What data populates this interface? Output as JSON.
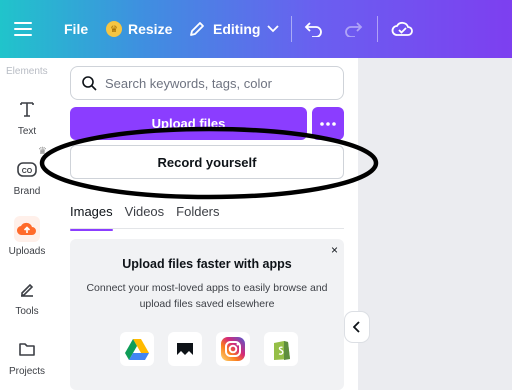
{
  "topbar": {
    "file_label": "File",
    "resize_label": "Resize",
    "editing_label": "Editing"
  },
  "rail": {
    "faded_label": "Elements",
    "items": [
      {
        "label": "Text",
        "icon": "text-icon"
      },
      {
        "label": "Brand",
        "icon": "brand-icon"
      },
      {
        "label": "Uploads",
        "icon": "uploads-icon"
      },
      {
        "label": "Tools",
        "icon": "tools-icon"
      },
      {
        "label": "Projects",
        "icon": "projects-icon"
      }
    ]
  },
  "panel": {
    "search_placeholder": "Search keywords, tags, color",
    "upload_label": "Upload files",
    "record_label": "Record yourself",
    "tabs": [
      "Images",
      "Videos",
      "Folders"
    ],
    "active_tab": "Images",
    "promo": {
      "title": "Upload files faster with apps",
      "description": "Connect your most-loved apps to easily browse and upload files saved elsewhere",
      "close_symbol": "×",
      "apps": [
        "google-drive-icon",
        "frameio-icon",
        "instagram-icon",
        "shopify-icon"
      ]
    }
  },
  "colors": {
    "accent": "#8b3dff",
    "uploads": "#ff6b2b",
    "annotation": "#000000"
  }
}
